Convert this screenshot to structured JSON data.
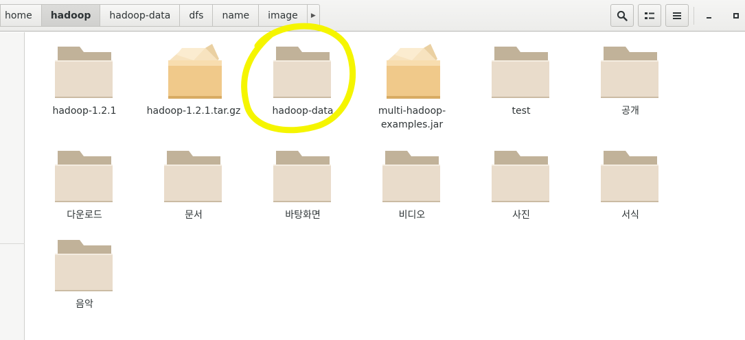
{
  "pathbar": {
    "crumbs": [
      "home",
      "hadoop",
      "hadoop-data",
      "dfs",
      "name",
      "image"
    ],
    "active_index": 1
  },
  "toolbar": {
    "search_icon": "search-icon",
    "view_icon": "view-options-icon",
    "menu_icon": "hamburger-menu-icon",
    "minimize_icon": "minimize-icon",
    "maximize_icon": "maximize-icon"
  },
  "files": [
    {
      "name": "hadoop-1.2.1",
      "type": "folder"
    },
    {
      "name": "hadoop-1.2.1.tar.gz",
      "type": "archive"
    },
    {
      "name": "hadoop-data",
      "type": "folder"
    },
    {
      "name": "multi-hadoop-examples.jar",
      "type": "archive"
    },
    {
      "name": "test",
      "type": "folder"
    },
    {
      "name": "공개",
      "type": "folder"
    },
    {
      "name": "다운로드",
      "type": "folder"
    },
    {
      "name": "문서",
      "type": "folder"
    },
    {
      "name": "바탕화면",
      "type": "folder"
    },
    {
      "name": "비디오",
      "type": "folder"
    },
    {
      "name": "사진",
      "type": "folder"
    },
    {
      "name": "서식",
      "type": "folder"
    },
    {
      "name": "음악",
      "type": "folder"
    }
  ],
  "colors": {
    "annotation": "#f5f500",
    "folder_front": "#e9dccb",
    "folder_back": "#c1b299",
    "archive": "#f0c98a"
  }
}
